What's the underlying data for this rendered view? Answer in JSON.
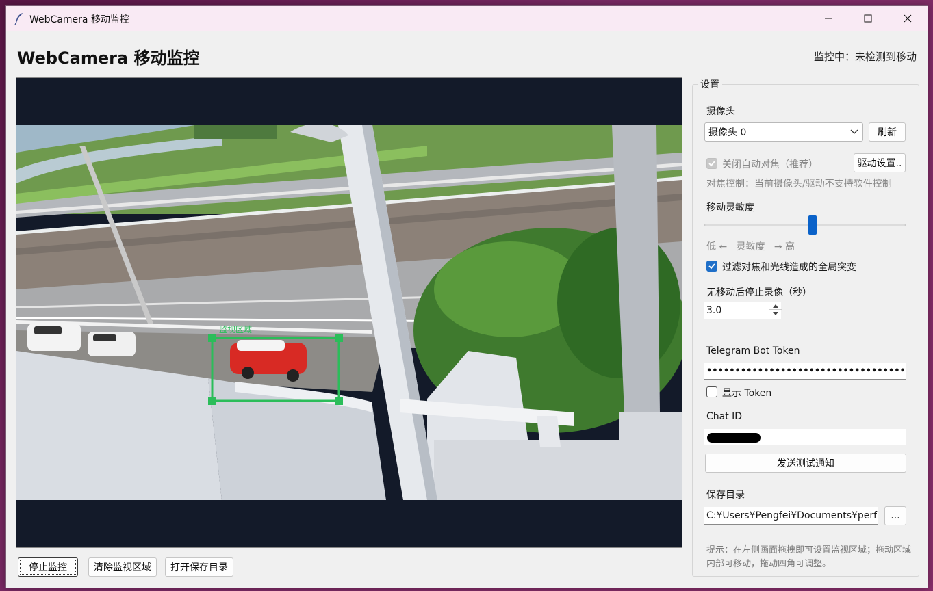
{
  "window": {
    "title": "WebCamera 移动监控",
    "controls": [
      "minimize-icon",
      "maximize-icon",
      "close-icon"
    ]
  },
  "header": {
    "title": "WebCamera 移动监控",
    "status": "监控中：未检测到移动"
  },
  "preview": {
    "roi_label": "监视区域",
    "roi_color": "#2bbd5a"
  },
  "bottom_buttons": {
    "stop": "停止监控",
    "clear_roi": "清除监视区域",
    "open_dir": "打开保存目录"
  },
  "settings": {
    "legend": "设置",
    "camera_label": "摄像头",
    "camera_selected": "摄像头 0",
    "refresh": "刷新",
    "autofocus_label": "关闭自动对焦（推荐）",
    "autofocus_checked": true,
    "autofocus_disabled": true,
    "driver_settings": "驱动设置..",
    "focus_note": "对焦控制：当前摄像头/驱动不支持软件控制",
    "sensitivity_label": "移动灵敏度",
    "sensitivity_value": 0.54,
    "sensitivity_scale": "低 ←   灵敏度   → 高",
    "filter_label": "过滤对焦和光线造成的全局突变",
    "filter_checked": true,
    "stop_delay_label": "无移动后停止录像（秒）",
    "stop_delay_value": "3.0",
    "telegram_label": "Telegram Bot Token",
    "telegram_value": "••••••••••••••••••••••••••••••••••••••••••••••••••••••",
    "show_token_label": "显示 Token",
    "show_token_checked": false,
    "chat_id_label": "Chat ID",
    "test_button": "发送测试通知",
    "save_dir_label": "保存目录",
    "save_dir_value": "C:¥Users¥Pengfei¥Documents¥perfact",
    "browse_button": "...",
    "hint": "提示：在左侧画面拖拽即可设置监视区域；拖动区域内部可移动，拖动四角可调整。"
  },
  "colors": {
    "accent": "#0a62c9",
    "titlebar": "#f9eaf4",
    "preview_bg": "#131a29",
    "roi": "#2bbd5a"
  }
}
